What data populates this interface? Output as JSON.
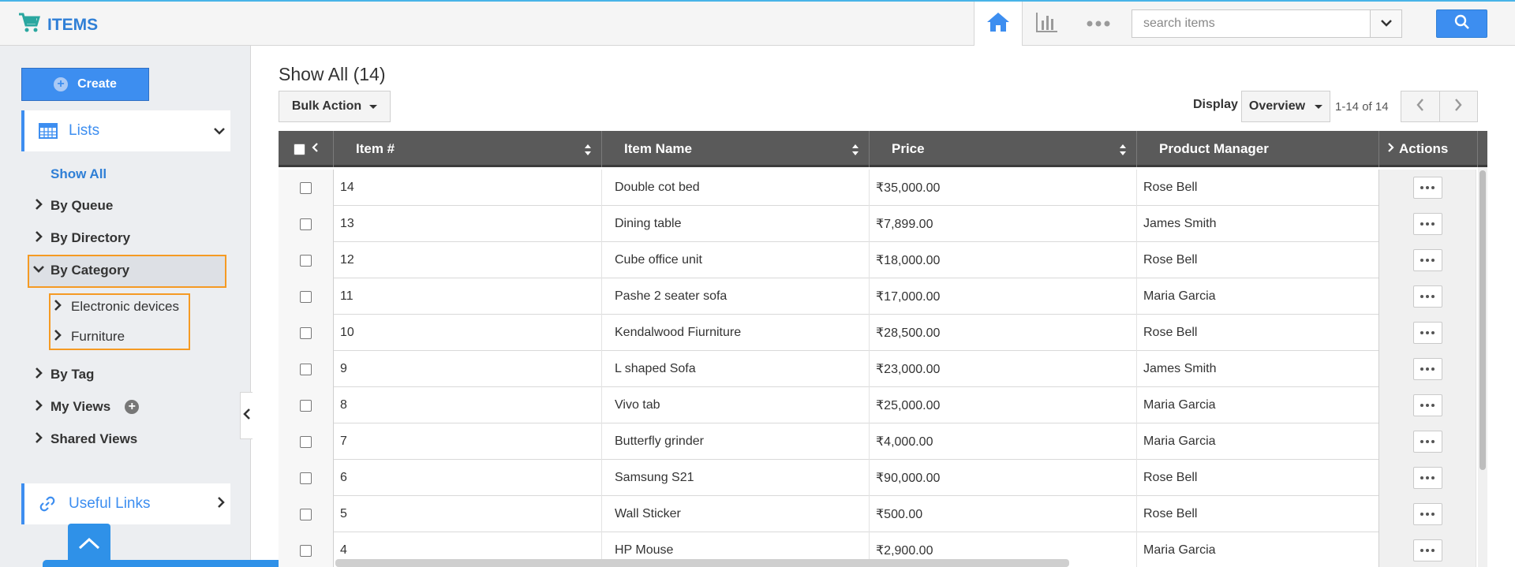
{
  "app": {
    "title": "ITEMS",
    "accent": "#3d8ef0",
    "highlight": "#f59a23"
  },
  "header": {
    "icons": [
      "cart-icon",
      "home-icon",
      "chart-icon",
      "more-icon",
      "chevron-down-icon",
      "search-icon"
    ],
    "search_placeholder": "search items"
  },
  "sidebar": {
    "create_label": "Create",
    "lists_label": "Lists",
    "show_all_label": "Show All",
    "items": {
      "by_queue": "By Queue",
      "by_directory": "By Directory",
      "by_category": "By Category",
      "by_tag": "By Tag",
      "my_views": "My Views",
      "shared_views": "Shared Views"
    },
    "categories": [
      "Electronic devices",
      "Furniture"
    ],
    "useful_links_label": "Useful Links"
  },
  "main": {
    "title": "Show All (14)",
    "bulk_action_label": "Bulk Action",
    "display_label": "Display",
    "display_value": "Overview",
    "range_label": "1-14 of 14"
  },
  "table": {
    "columns": [
      "Item #",
      "Item Name",
      "Price",
      "Product Manager",
      "Actions"
    ],
    "rows": [
      {
        "num": "14",
        "name": "Double cot bed",
        "price": "₹35,000.00",
        "manager": "Rose Bell"
      },
      {
        "num": "13",
        "name": "Dining table",
        "price": "₹7,899.00",
        "manager": "James Smith"
      },
      {
        "num": "12",
        "name": "Cube office unit",
        "price": "₹18,000.00",
        "manager": "Rose Bell"
      },
      {
        "num": "11",
        "name": "Pashe 2 seater sofa",
        "price": "₹17,000.00",
        "manager": "Maria Garcia"
      },
      {
        "num": "10",
        "name": "Kendalwood Fiurniture",
        "price": "₹28,500.00",
        "manager": "Rose Bell"
      },
      {
        "num": "9",
        "name": "L shaped Sofa",
        "price": "₹23,000.00",
        "manager": "James Smith"
      },
      {
        "num": "8",
        "name": "Vivo tab",
        "price": "₹25,000.00",
        "manager": "Maria Garcia"
      },
      {
        "num": "7",
        "name": "Butterfly grinder",
        "price": "₹4,000.00",
        "manager": "Maria Garcia"
      },
      {
        "num": "6",
        "name": "Samsung S21",
        "price": "₹90,000.00",
        "manager": "Rose Bell"
      },
      {
        "num": "5",
        "name": "Wall Sticker",
        "price": "₹500.00",
        "manager": "Rose Bell"
      },
      {
        "num": "4",
        "name": "HP Mouse",
        "price": "₹2,900.00",
        "manager": "Maria Garcia"
      }
    ]
  }
}
